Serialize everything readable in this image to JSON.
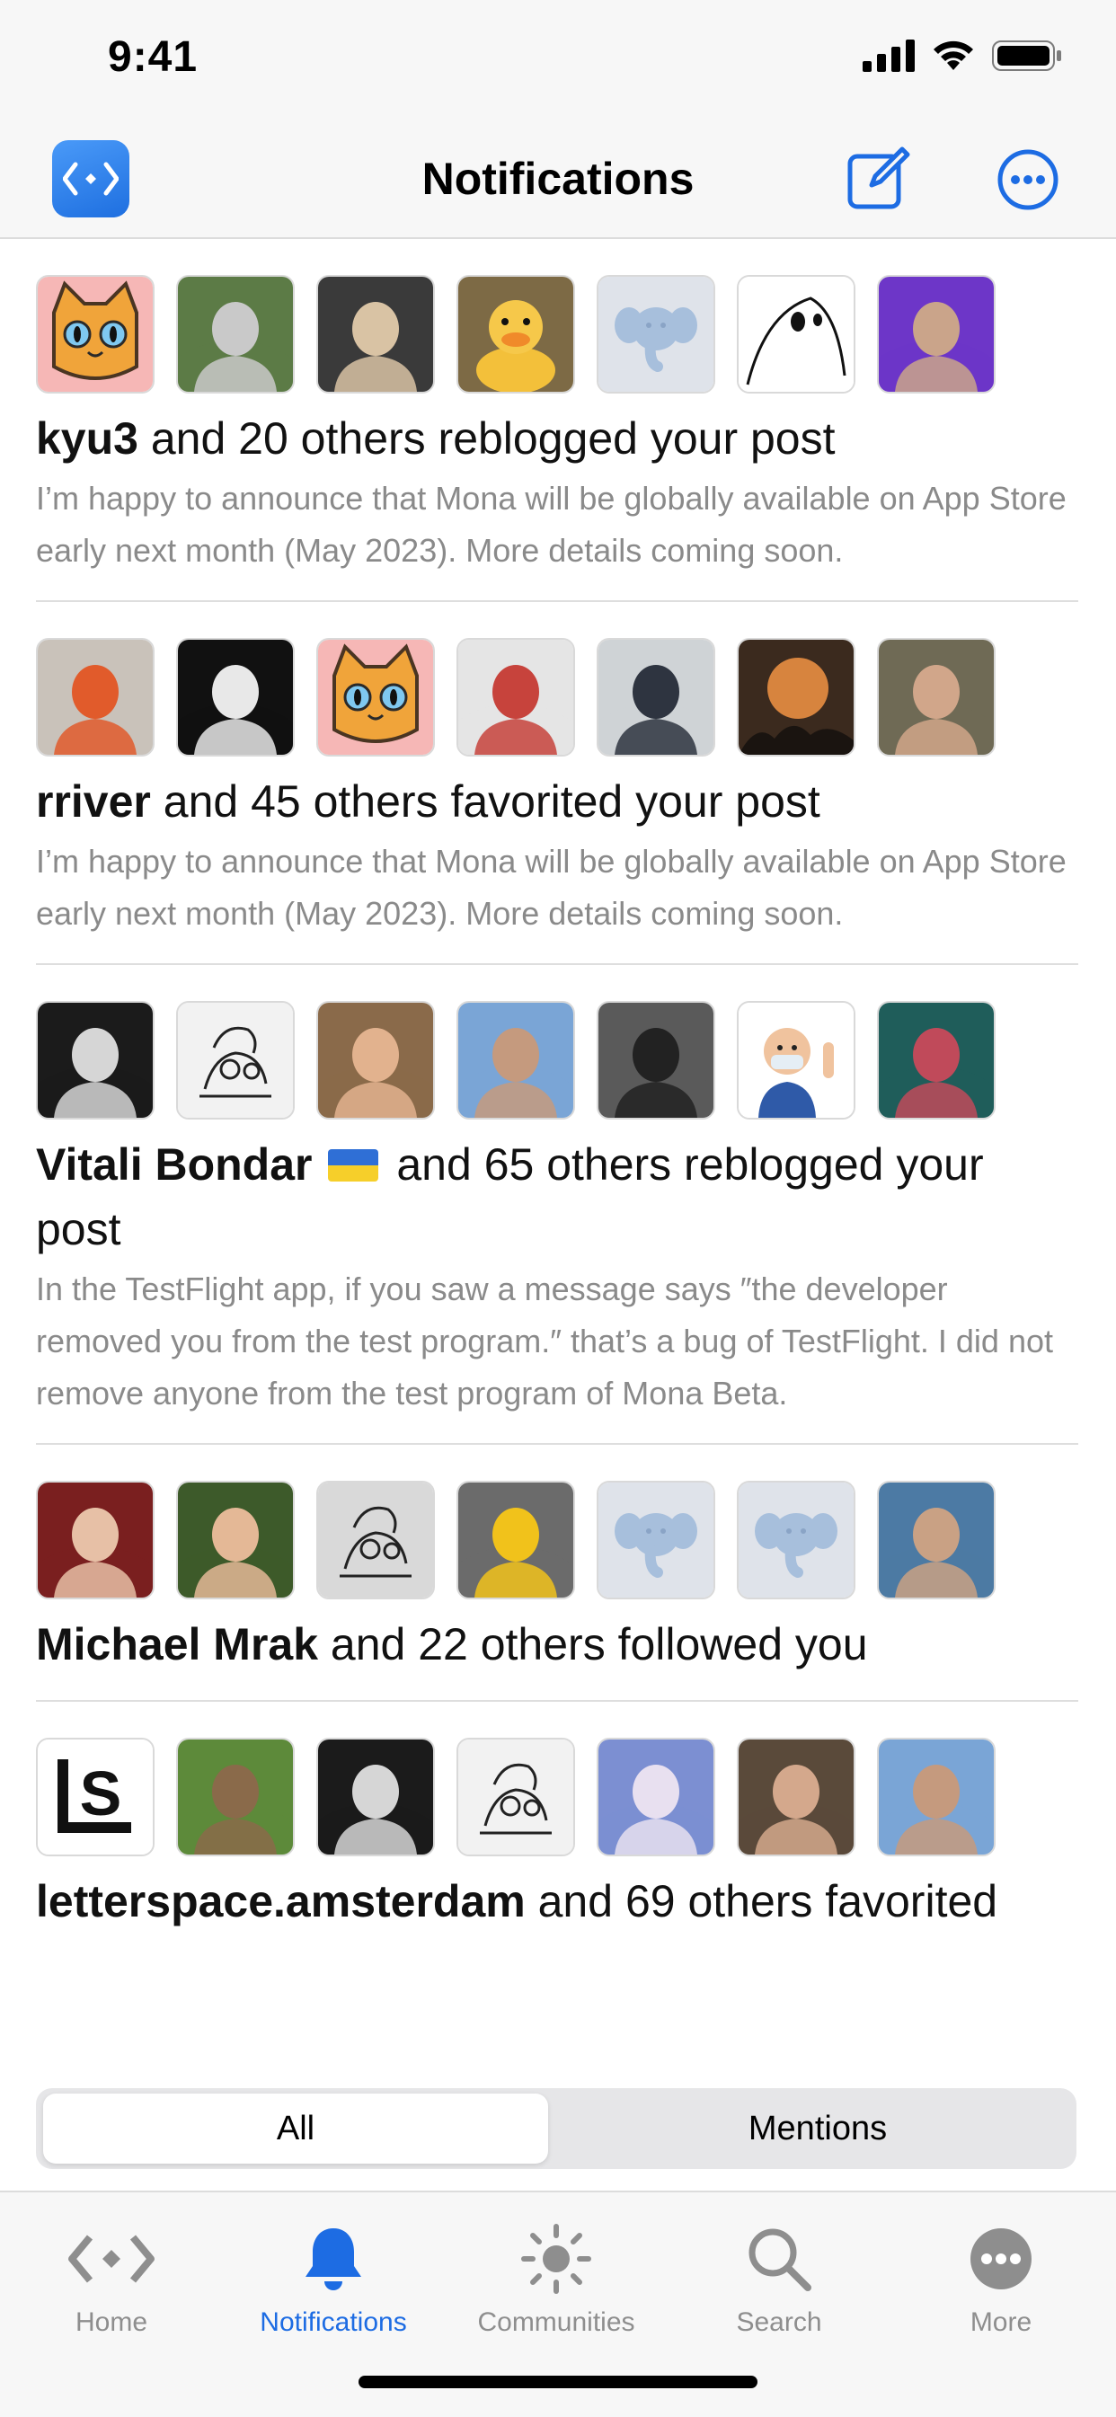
{
  "status": {
    "time": "9:41"
  },
  "nav": {
    "title": "Notifications"
  },
  "icons": {
    "app": "app-logo-icon",
    "compose": "compose-icon",
    "more": "ellipsis-circle-icon"
  },
  "colors": {
    "accent": "#1d6ce3",
    "excerpt": "#8a8a8a"
  },
  "notifications": [
    {
      "user": "kyu3",
      "action": " and 20 others reblogged your post",
      "excerpt": "I’m happy to announce that Mona will be globally available on App Store early next month (May 2023). More details coming soon.",
      "avatars": [
        {
          "kind": "cat",
          "bg": "#f6b7b6"
        },
        {
          "kind": "photo",
          "bg": "#5c7b46",
          "fg": "#c9c9c9"
        },
        {
          "kind": "photo",
          "bg": "#3a3a3a",
          "fg": "#d9c3a4"
        },
        {
          "kind": "duck",
          "bg": "#7d6a45"
        },
        {
          "kind": "elephant",
          "bg": "#dfe3ea"
        },
        {
          "kind": "ghost",
          "bg": "#ffffff"
        },
        {
          "kind": "photo",
          "bg": "#6d36c8",
          "fg": "#caa48a"
        }
      ]
    },
    {
      "user": "rriver",
      "action": " and 45 others favorited your post",
      "excerpt": "I’m happy to announce that Mona will be globally available on App Store early next month (May 2023). More details coming soon.",
      "avatars": [
        {
          "kind": "photo",
          "bg": "#c9c2ba",
          "fg": "#e15b2b"
        },
        {
          "kind": "photo",
          "bg": "#111111",
          "fg": "#e8e8e8"
        },
        {
          "kind": "cat",
          "bg": "#f6b7b6"
        },
        {
          "kind": "photo",
          "bg": "#e5e5e5",
          "fg": "#c7433c"
        },
        {
          "kind": "photo",
          "bg": "#cfd3d6",
          "fg": "#2e3440"
        },
        {
          "kind": "moon",
          "bg": "#3b2a1e"
        },
        {
          "kind": "photo",
          "bg": "#6f6a55",
          "fg": "#d1a68a"
        }
      ]
    },
    {
      "user": "Vitali Bondar",
      "flag": true,
      "action": " and 65 others reblogged your post",
      "excerpt": "In the TestFlight app, if you saw a message says ″the developer removed you from the test program.″ that’s a bug of TestFlight. I did not remove anyone from the test program of Mona Beta.",
      "avatars": [
        {
          "kind": "photo",
          "bg": "#1b1b1b",
          "fg": "#d6d6d6"
        },
        {
          "kind": "sketch",
          "bg": "#f2f2f2"
        },
        {
          "kind": "photo",
          "bg": "#8a6a4a",
          "fg": "#e2b28e"
        },
        {
          "kind": "photo",
          "bg": "#7aa5d6",
          "fg": "#c59a7e"
        },
        {
          "kind": "photo",
          "bg": "#5a5a5a",
          "fg": "#222"
        },
        {
          "kind": "memoji",
          "bg": "#ffffff"
        },
        {
          "kind": "photo",
          "bg": "#1f5d5a",
          "fg": "#c04a5a"
        }
      ]
    },
    {
      "user": "Michael Mrak",
      "action": " and 22 others followed you",
      "excerpt": "",
      "avatars": [
        {
          "kind": "photo",
          "bg": "#7a1f1f",
          "fg": "#e7c0a6"
        },
        {
          "kind": "photo",
          "bg": "#3d5a2a",
          "fg": "#e4b896"
        },
        {
          "kind": "sketch",
          "bg": "#d9d9d9"
        },
        {
          "kind": "photo",
          "bg": "#6b6b6b",
          "fg": "#f1c21b"
        },
        {
          "kind": "elephant",
          "bg": "#dfe3ea"
        },
        {
          "kind": "elephant",
          "bg": "#dfe3ea"
        },
        {
          "kind": "photo",
          "bg": "#4c7aa4",
          "fg": "#c9a184"
        }
      ]
    },
    {
      "user": "letterspace.amsterdam",
      "action": " and 69 others favorited",
      "excerpt": "",
      "avatars": [
        {
          "kind": "ls",
          "bg": "#ffffff"
        },
        {
          "kind": "photo",
          "bg": "#5d8a3a",
          "fg": "#8a6a4a"
        },
        {
          "kind": "photo",
          "bg": "#1b1b1b",
          "fg": "#d6d6d6"
        },
        {
          "kind": "sketch",
          "bg": "#f2f2f2"
        },
        {
          "kind": "photo",
          "bg": "#7c8fd2",
          "fg": "#e8e0f0"
        },
        {
          "kind": "photo",
          "bg": "#5a4a3a",
          "fg": "#d4a88c"
        },
        {
          "kind": "photo",
          "bg": "#7aa5d6",
          "fg": "#c59a7e"
        }
      ]
    }
  ],
  "segments": {
    "all": "All",
    "mentions": "Mentions",
    "selected": "All"
  },
  "tabs": [
    {
      "label": "Home",
      "icon": "home-diamond-icon"
    },
    {
      "label": "Notifications",
      "icon": "bell-icon",
      "active": true
    },
    {
      "label": "Communities",
      "icon": "sun-icon"
    },
    {
      "label": "Search",
      "icon": "magnifier-icon"
    },
    {
      "label": "More",
      "icon": "ellipsis-circle-icon"
    }
  ]
}
